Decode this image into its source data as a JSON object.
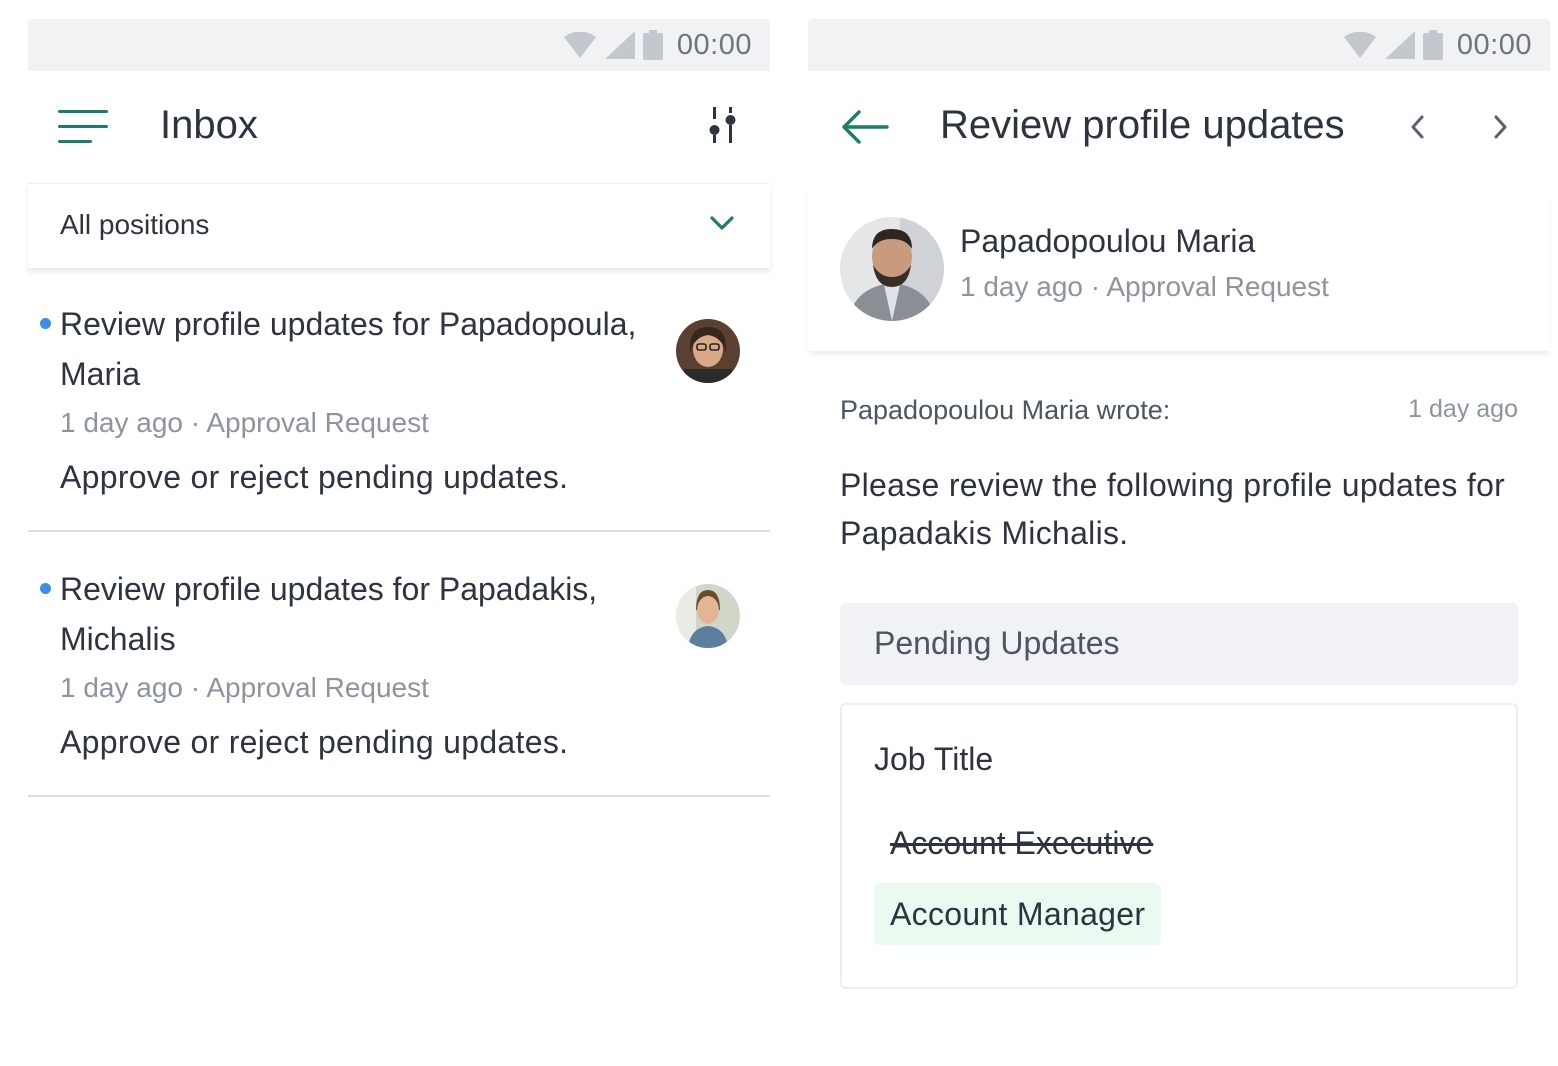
{
  "status_bar": {
    "time": "00:00"
  },
  "colors": {
    "accent": "#1e7a6c",
    "unread_dot": "#3d8de8",
    "status_bar_bg": "#f1f2f4",
    "new_value_bg": "#eafaf0"
  },
  "icons": {
    "menu": "menu-icon",
    "filter": "sliders-icon",
    "chevron": "chevron-down-icon",
    "back": "arrow-left-icon",
    "prev": "chevron-left-icon",
    "next": "chevron-right-icon",
    "wifi": "wifi-icon",
    "signal": "signal-icon",
    "battery": "battery-icon"
  },
  "inbox": {
    "title": "Inbox",
    "filter_label": "All positions",
    "items": [
      {
        "title": "Review profile updates for Papadopoula, Maria",
        "meta": "1 day ago · Approval Request",
        "description": "Approve or reject pending updates.",
        "unread": true
      },
      {
        "title": "Review profile updates for Papadakis, Michalis",
        "meta": "1 day ago · Approval Request",
        "description": "Approve or reject pending updates.",
        "unread": true
      }
    ]
  },
  "detail": {
    "title": "Review profile updates",
    "sender": {
      "name": "Papadopoulou Maria",
      "meta": "1 day ago · Approval Request"
    },
    "wrote_label": "Papadopoulou Maria wrote:",
    "wrote_time": "1 day ago",
    "message": "Please review the following profile updates for Papadakis Michalis.",
    "section_title": "Pending Updates",
    "changes": [
      {
        "field": "Job Title",
        "old_value": "Account Executive",
        "new_value": "Account Manager"
      }
    ]
  }
}
